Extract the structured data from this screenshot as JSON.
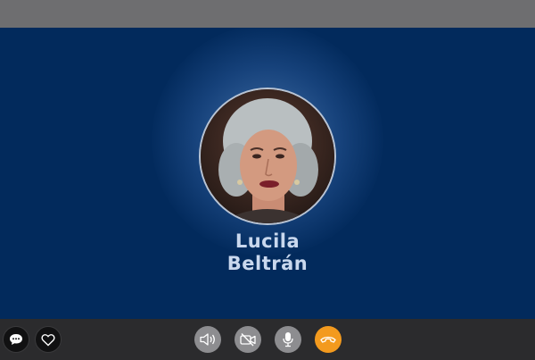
{
  "caller": {
    "first_name": "Lucila",
    "last_name": "Beltrán"
  },
  "controls": {
    "left": [
      {
        "icon": "chat-bubble-icon"
      },
      {
        "icon": "heart-icon"
      }
    ],
    "center": [
      {
        "icon": "speaker-icon",
        "color": "#8d8d90"
      },
      {
        "icon": "video-off-icon",
        "color": "#8d8d90"
      },
      {
        "icon": "microphone-icon",
        "color": "#8d8d90"
      },
      {
        "icon": "hang-up-icon",
        "color": "#f39a1e"
      }
    ]
  },
  "colors": {
    "stage_background": "#022a5c",
    "top_bar": "#6e6e70",
    "control_bar": "#2b2b2d",
    "name_text": "#c9d8ee",
    "hang_up": "#f39a1e"
  }
}
